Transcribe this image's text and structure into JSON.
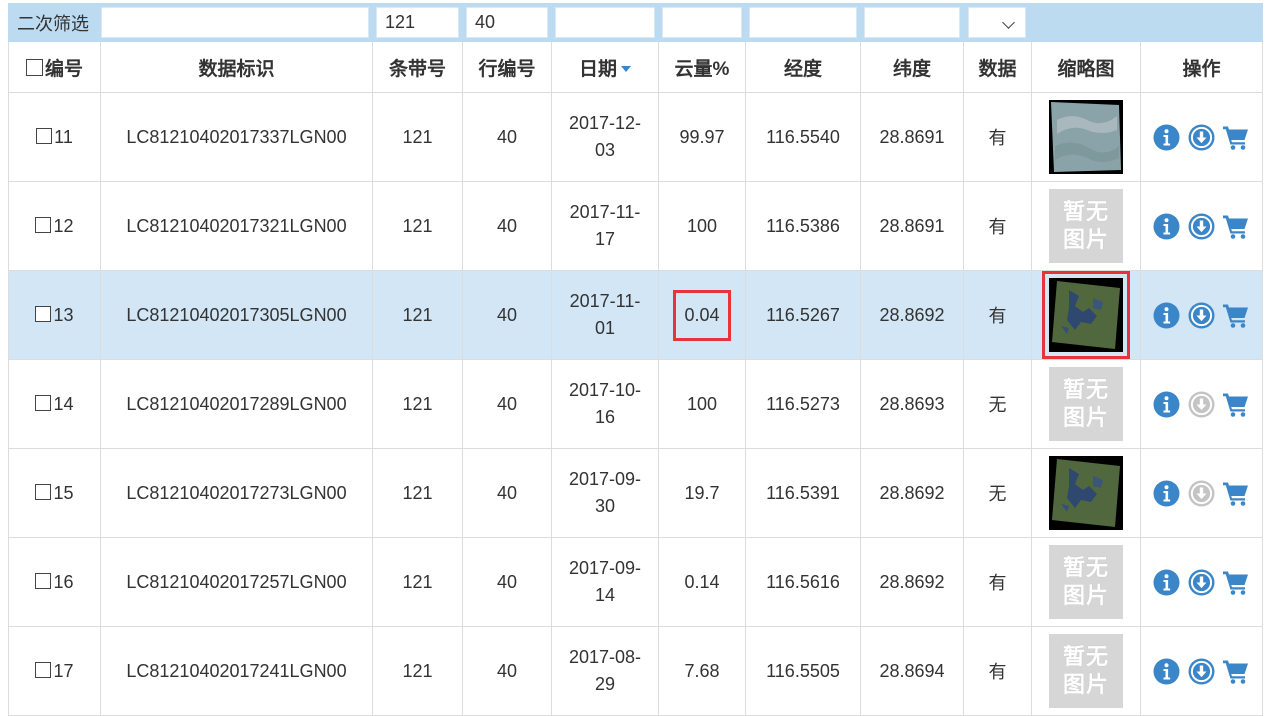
{
  "filter": {
    "label": "二次筛选",
    "band_value": "121",
    "row_value": "40"
  },
  "headers": {
    "select": "编号",
    "id": "数据标识",
    "path": "条带号",
    "row": "行编号",
    "date": "日期",
    "cloud": "云量%",
    "lon": "经度",
    "lat": "纬度",
    "data": "数据",
    "thumb": "缩略图",
    "ops": "操作"
  },
  "no_image_text": [
    "暂无",
    "图片"
  ],
  "rows": [
    {
      "no": "11",
      "id": "LC81210402017337LGN00",
      "path": "121",
      "row": "40",
      "date1": "2017-12-",
      "date2": "03",
      "cloud": "99.97",
      "lon": "116.5540",
      "lat": "28.8691",
      "data": "有",
      "thumb": "cloudy",
      "download_enabled": true
    },
    {
      "no": "12",
      "id": "LC81210402017321LGN00",
      "path": "121",
      "row": "40",
      "date1": "2017-11-",
      "date2": "17",
      "cloud": "100",
      "lon": "116.5386",
      "lat": "28.8691",
      "data": "有",
      "thumb": "none",
      "download_enabled": true
    },
    {
      "no": "13",
      "id": "LC81210402017305LGN00",
      "path": "121",
      "row": "40",
      "date1": "2017-11-",
      "date2": "01",
      "cloud": "0.04",
      "lon": "116.5267",
      "lat": "28.8692",
      "data": "有",
      "thumb": "clear",
      "download_enabled": true,
      "selected": true
    },
    {
      "no": "14",
      "id": "LC81210402017289LGN00",
      "path": "121",
      "row": "40",
      "date1": "2017-10-",
      "date2": "16",
      "cloud": "100",
      "lon": "116.5273",
      "lat": "28.8693",
      "data": "无",
      "thumb": "none",
      "download_enabled": false
    },
    {
      "no": "15",
      "id": "LC81210402017273LGN00",
      "path": "121",
      "row": "40",
      "date1": "2017-09-",
      "date2": "30",
      "cloud": "19.7",
      "lon": "116.5391",
      "lat": "28.8692",
      "data": "无",
      "thumb": "clear",
      "download_enabled": false
    },
    {
      "no": "16",
      "id": "LC81210402017257LGN00",
      "path": "121",
      "row": "40",
      "date1": "2017-09-",
      "date2": "14",
      "cloud": "0.14",
      "lon": "116.5616",
      "lat": "28.8692",
      "data": "有",
      "thumb": "none",
      "download_enabled": true
    },
    {
      "no": "17",
      "id": "LC81210402017241LGN00",
      "path": "121",
      "row": "40",
      "date1": "2017-08-",
      "date2": "29",
      "cloud": "7.68",
      "lon": "116.5505",
      "lat": "28.8694",
      "data": "有",
      "thumb": "none",
      "download_enabled": true
    }
  ],
  "icons": {
    "info": "info-icon",
    "download": "download-icon",
    "cart": "cart-icon"
  },
  "colors": {
    "accent": "#3a86c8",
    "disabled": "#c4c4c4",
    "filter_bar": "#bcdaf0",
    "selected_row": "#d2e6f6",
    "highlight": "#e8333a"
  }
}
